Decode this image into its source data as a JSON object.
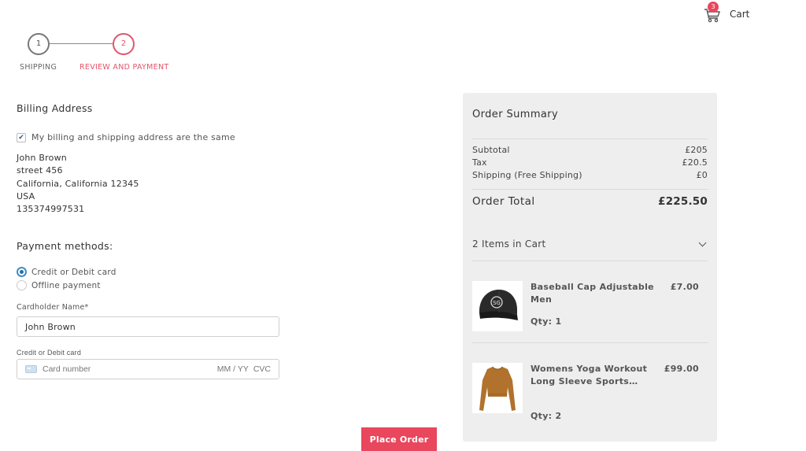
{
  "header": {
    "cart_label": "Cart",
    "cart_count": "3"
  },
  "stepper": {
    "steps": [
      {
        "number": "1",
        "label": "SHIPPING"
      },
      {
        "number": "2",
        "label": "REVIEW AND PAYMENT"
      }
    ],
    "active_color": "#e0566b"
  },
  "billing": {
    "title": "Billing Address",
    "same_label": "My billing and shipping address are the same",
    "same_checked": true,
    "address_lines": [
      "John Brown",
      "street 456",
      "California, California 12345",
      "USA",
      "135374997531"
    ]
  },
  "payment": {
    "title": "Payment methods:",
    "options": [
      {
        "label": "Credit or Debit card",
        "selected": true
      },
      {
        "label": "Offline payment",
        "selected": false
      }
    ],
    "cardholder_label": "Cardholder Name",
    "cardholder_required": "*",
    "cardholder_value": "John Brown",
    "card_label": "Credit or Debit card",
    "card_number_placeholder": "Card number",
    "card_expiry_placeholder": "MM / YY",
    "card_cvc_placeholder": "CVC"
  },
  "place_order_label": "Place Order",
  "summary": {
    "title": "Order Summary",
    "subtotal_label": "Subtotal",
    "subtotal_value": "£205",
    "tax_label": "Tax",
    "tax_value": "£20.5",
    "shipping_label": "Shipping (Free Shipping)",
    "shipping_value": "£0",
    "total_label": "Order Total",
    "total_value": "£225.50",
    "items_label": "2 Items in Cart",
    "items": [
      {
        "name": "Baseball Cap Adjustable Men",
        "price": "£7.00",
        "qty": "Qty: 1",
        "icon": "baseball-cap-icon"
      },
      {
        "name": "Womens Yoga Workout Long Sleeve Sports…",
        "price": "£99.00",
        "qty": "Qty: 2",
        "icon": "long-sleeve-top-icon"
      }
    ]
  },
  "colors": {
    "accent": "#e8475d",
    "summary_bg": "#eeeeee",
    "radio_selected": "#3d8fc6"
  }
}
